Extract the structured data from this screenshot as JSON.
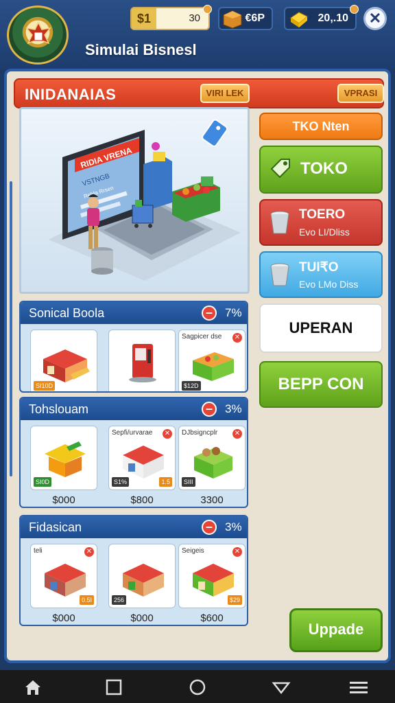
{
  "topbar": {
    "app_title": "Simulai Bisnesl",
    "money_symbol": "$1",
    "money_value": "30",
    "boxes_value": "€6P",
    "gold_value": "20,.10",
    "close_label": "✕"
  },
  "header": {
    "title": "INIDANAIAS",
    "btn_left": "VIRI LEK",
    "btn_right": "VPRASI"
  },
  "hero": {
    "screen_banner": "RIDIA VRENA",
    "screen_subtitle": "VSTNGB",
    "screen_text": "Refda Rrsen"
  },
  "menu": {
    "m1": "TKO Nten",
    "m2": "TOKO",
    "m3_title": "TOERO",
    "m3_sub": "Evo LI/Dliss",
    "m4_title": "TUI₹O",
    "m4_sub": "Evo LMo Diss",
    "m5": "UPERAN",
    "m6": "BEPP CON"
  },
  "categories": [
    {
      "name": "Sonical Boola",
      "pct": "7%",
      "cards": [
        {
          "tag": "SI10D",
          "cap": "",
          "price": ""
        },
        {
          "tag": "",
          "cap": "",
          "price": ""
        },
        {
          "tag": "$12D",
          "cap": "Sagpicer dse",
          "price": ""
        }
      ]
    },
    {
      "name": "Tohslouam",
      "pct": "3%",
      "cards": [
        {
          "tag": "SI0D",
          "cap": "",
          "price": "$000"
        },
        {
          "tag": "S1%",
          "tag2": "1.5",
          "cap": "Sepfi/urvarae",
          "price": "$800"
        },
        {
          "tag": "SIII",
          "cap": "DJbsigncplr",
          "price": "3300"
        }
      ]
    },
    {
      "name": "Fidasican",
      "pct": "3%",
      "cards": [
        {
          "tag": "",
          "tag2": "0.5I",
          "cap": "teli",
          "price": "$000"
        },
        {
          "tag": "256",
          "cap": "",
          "price": "$000"
        },
        {
          "tag": "",
          "tag2": "$29",
          "cap": "Seigeis",
          "price": "$600"
        }
      ]
    }
  ],
  "upgrade_label": "Uppade",
  "colors": {
    "accent_red": "#d13b1f",
    "accent_green": "#5fa21b",
    "frame_blue": "#2b5ea8"
  }
}
